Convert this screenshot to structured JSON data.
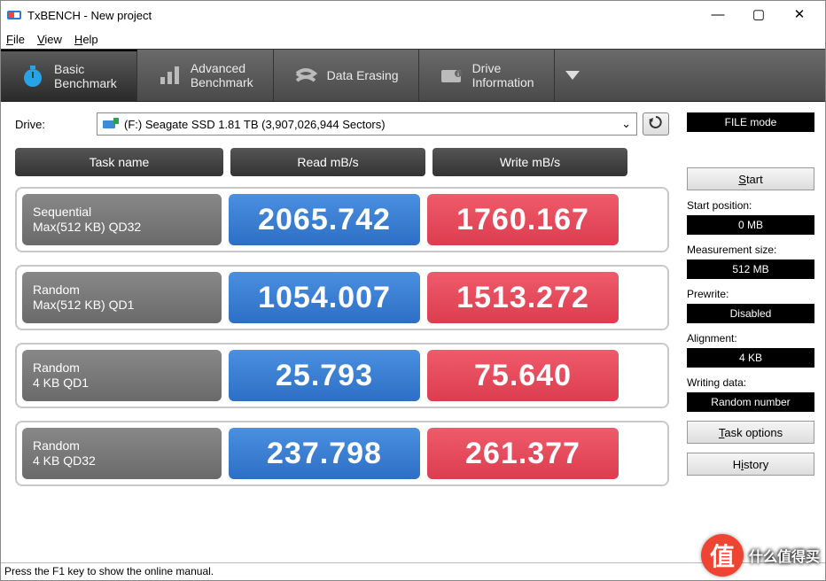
{
  "window": {
    "title": "TxBENCH - New project"
  },
  "menu": {
    "file": "File",
    "view": "View",
    "help": "Help"
  },
  "tabs": {
    "basic": "Basic\nBenchmark",
    "advanced": "Advanced\nBenchmark",
    "erasing": "Data Erasing",
    "drive_info": "Drive\nInformation"
  },
  "drive": {
    "label": "Drive:",
    "value": "(F:) Seagate SSD  1.81 TB (3,907,026,944 Sectors)"
  },
  "columns": {
    "task": "Task name",
    "read": "Read mB/s",
    "write": "Write mB/s"
  },
  "results": [
    {
      "name1": "Sequential",
      "name2": "Max(512 KB) QD32",
      "read": "2065.742",
      "write": "1760.167"
    },
    {
      "name1": "Random",
      "name2": "Max(512 KB) QD1",
      "read": "1054.007",
      "write": "1513.272"
    },
    {
      "name1": "Random",
      "name2": "4 KB QD1",
      "read": "25.793",
      "write": "75.640"
    },
    {
      "name1": "Random",
      "name2": "4 KB QD32",
      "read": "237.798",
      "write": "261.377"
    }
  ],
  "sidebar": {
    "file_mode": "FILE mode",
    "start": "Start",
    "start_position_label": "Start position:",
    "start_position_value": "0 MB",
    "measurement_label": "Measurement size:",
    "measurement_value": "512 MB",
    "prewrite_label": "Prewrite:",
    "prewrite_value": "Disabled",
    "alignment_label": "Alignment:",
    "alignment_value": "4 KB",
    "writing_label": "Writing data:",
    "writing_value": "Random number",
    "task_options": "Task options",
    "history": "History"
  },
  "status": "Press the F1 key to show the online manual.",
  "watermark": "什么值得买",
  "chart_data": {
    "type": "table",
    "title": "TxBENCH Basic Benchmark Results",
    "columns": [
      "Task name",
      "Read mB/s",
      "Write mB/s"
    ],
    "rows": [
      [
        "Sequential Max(512 KB) QD32",
        2065.742,
        1760.167
      ],
      [
        "Random Max(512 KB) QD1",
        1054.007,
        1513.272
      ],
      [
        "Random 4 KB QD1",
        25.793,
        75.64
      ],
      [
        "Random 4 KB QD32",
        237.798,
        261.377
      ]
    ]
  }
}
